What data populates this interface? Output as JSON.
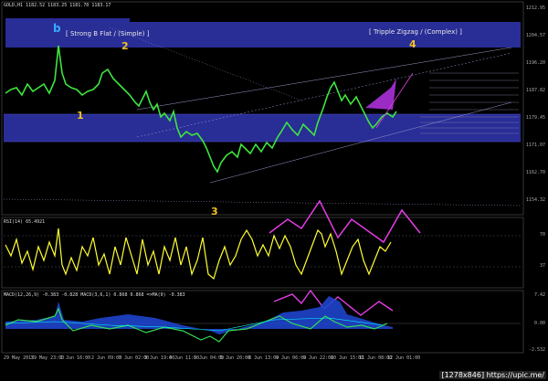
{
  "main": {
    "header": "GOLD,H1  1182.52 1183.25 1181.70 1183.17",
    "box_left_label": "[ Strong B Flat / (Simple) ]",
    "box_right_label": "[ Tripple Zigzag / (Complex) ]",
    "wave_labels": [
      "b",
      "1",
      "2",
      "3",
      "4"
    ],
    "price_axis": [
      "1212.95",
      "1204.57",
      "1196.20",
      "1187.82",
      "1179.45",
      "1171.07",
      "1162.70",
      "1154.32"
    ],
    "time_axis": [
      "29 May 2015",
      "29 May 23:00",
      "1 Jun 16:00",
      "2 Jun 09:00",
      "3 Jun 02:00",
      "3 Jun 19:00",
      "4 Jun 11:00",
      "5 Jun 04:00",
      "5 Jun 20:00",
      "8 Jun 13:00",
      "9 Jun 06:00",
      "9 Jun 22:00",
      "10 Jun 15:00",
      "11 Jun 08:00",
      "12 Jun 01:00"
    ],
    "colors": {
      "zone": "#2b2f9e",
      "zone_dark": "#1a1d6e",
      "candle_up": "#3ee53e",
      "candle_down": "#2fa82f",
      "wave_label": "#f4c21f",
      "wave_b": "#33aaff",
      "arrow": "#e63ce6"
    }
  },
  "rsi": {
    "header": "RSI(14) 65.4921",
    "levels": [
      "70",
      "37"
    ],
    "color": "#ffff33"
  },
  "macd": {
    "header": "MACD(12,26,9) -0.383 -0.828 MACD(3,6,1) 0.868 0.868 =>MA(0) -0.383",
    "levels": [
      "7.42",
      "0.00",
      "-2.532"
    ],
    "colors": {
      "fill": "#1e44cc",
      "line": "#33dd55",
      "signal": "#00ffff"
    }
  },
  "watermark": "[1278x846] https://upic.me/"
}
